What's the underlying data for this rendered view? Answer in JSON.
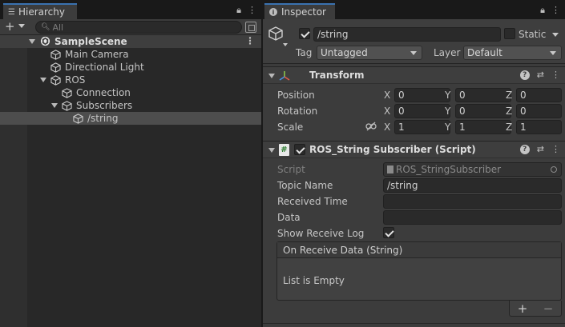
{
  "hierarchy": {
    "tab_label": "Hierarchy",
    "add_label": "+",
    "search_placeholder": "All",
    "scene_name": "SampleScene",
    "items": [
      {
        "label": "Main Camera"
      },
      {
        "label": "Directional Light"
      },
      {
        "label": "ROS"
      },
      {
        "label": "Connection"
      },
      {
        "label": "Subscribers"
      },
      {
        "label": "/string"
      }
    ]
  },
  "inspector": {
    "tab_label": "Inspector",
    "object_name": "/string",
    "static_label": "Static",
    "tag_label": "Tag",
    "tag_value": "Untagged",
    "layer_label": "Layer",
    "layer_value": "Default",
    "transform": {
      "title": "Transform",
      "position_label": "Position",
      "rotation_label": "Rotation",
      "scale_label": "Scale",
      "axis_x": "X",
      "axis_y": "Y",
      "axis_z": "Z",
      "position": [
        "0",
        "0",
        "0"
      ],
      "rotation": [
        "0",
        "0",
        "0"
      ],
      "scale": [
        "1",
        "1",
        "1"
      ]
    },
    "script_component": {
      "title": "ROS_String Subscriber (Script)",
      "script_label": "Script",
      "script_value": "ROS_StringSubscriber",
      "topic_label": "Topic Name",
      "topic_value": "/string",
      "received_time_label": "Received Time",
      "received_time_value": "",
      "data_label": "Data",
      "data_value": "",
      "show_log_label": "Show Receive Log",
      "event_title": "On Receive Data (String)",
      "event_empty": "List is Empty",
      "add_label": "+",
      "remove_label": "−"
    }
  },
  "colors": {
    "tab_accent": "#3a72b0",
    "panel_bg": "#3c3c3c",
    "hierarchy_bg": "#282828",
    "field_bg": "#2a2a2a"
  }
}
